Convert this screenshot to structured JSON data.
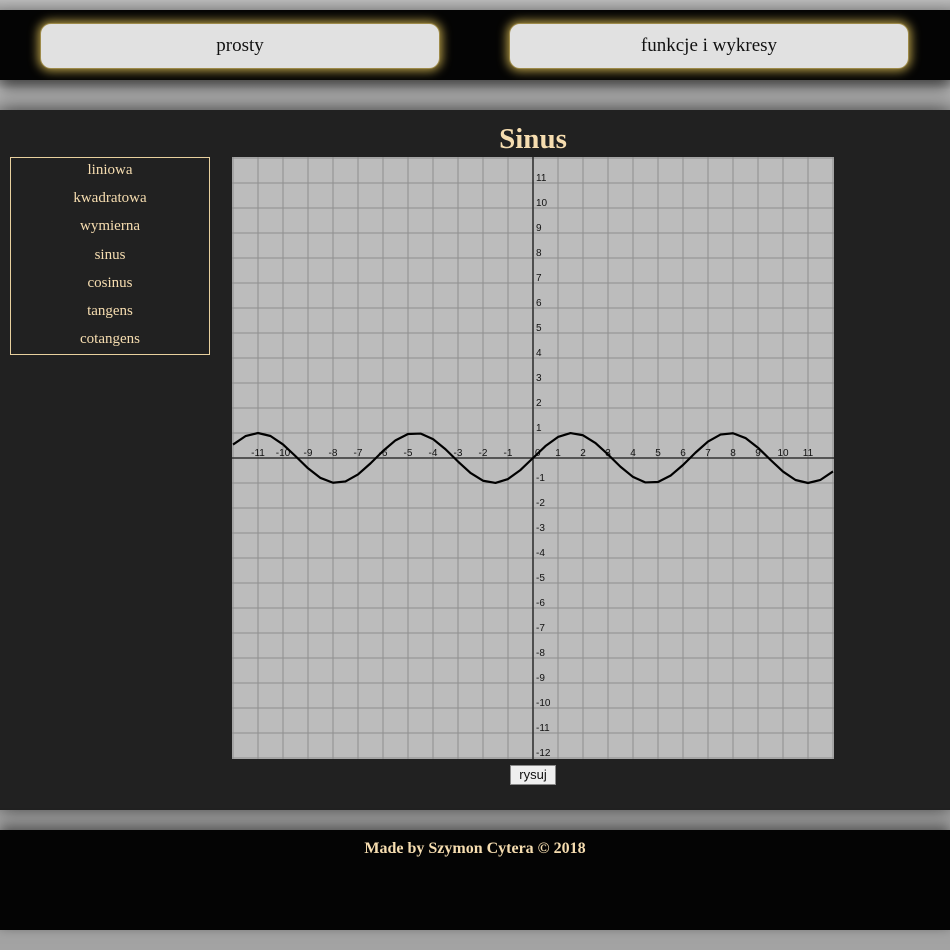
{
  "nav": {
    "items": [
      {
        "label": "prosty"
      },
      {
        "label": "funkcje i wykresy"
      }
    ]
  },
  "page": {
    "title": "Sinus"
  },
  "menu": {
    "items": [
      {
        "label": "liniowa"
      },
      {
        "label": "kwadratowa"
      },
      {
        "label": "wymierna"
      },
      {
        "label": "sinus"
      },
      {
        "label": "cosinus"
      },
      {
        "label": "tangens"
      },
      {
        "label": "cotangens"
      }
    ]
  },
  "controls": {
    "draw_label": "rysuj"
  },
  "footer": {
    "text": "Made by Szymon Cytera © 2018"
  },
  "colors": {
    "accent_text": "#f6ddb0",
    "panel_bg": "#212121",
    "graph_bg": "#bcbcbc"
  },
  "chart_data": {
    "type": "line",
    "title": "Sinus",
    "xlabel": "",
    "ylabel": "",
    "function": "sin(x)",
    "xlim": [
      -12,
      12
    ],
    "ylim": [
      -12,
      12
    ],
    "x_ticks": [
      -11,
      -10,
      -9,
      -8,
      -7,
      -6,
      -5,
      -4,
      -3,
      -2,
      -1,
      0,
      1,
      2,
      3,
      4,
      5,
      6,
      7,
      8,
      9,
      10,
      11
    ],
    "y_ticks": [
      11,
      10,
      9,
      8,
      7,
      6,
      5,
      4,
      3,
      2,
      1,
      -1,
      -2,
      -3,
      -4,
      -5,
      -6,
      -7,
      -8,
      -9,
      -10,
      -11,
      -12
    ],
    "grid": true,
    "series": [
      {
        "name": "",
        "x": [
          -12,
          -11.5,
          -11,
          -10.5,
          -10,
          -9.5,
          -9,
          -8.5,
          -8,
          -7.5,
          -7,
          -6.5,
          -6,
          -5.5,
          -5,
          -4.5,
          -4,
          -3.5,
          -3,
          -2.5,
          -2,
          -1.5,
          -1,
          -0.5,
          0,
          0.5,
          1,
          1.5,
          2,
          2.5,
          3,
          3.5,
          4,
          4.5,
          5,
          5.5,
          6,
          6.5,
          7,
          7.5,
          8,
          8.5,
          9,
          9.5,
          10,
          10.5,
          11,
          11.5,
          12
        ],
        "y": [
          0.537,
          0.876,
          1.0,
          0.88,
          0.544,
          0.075,
          -0.412,
          -0.798,
          -0.989,
          -0.938,
          -0.657,
          -0.215,
          0.279,
          0.706,
          0.959,
          0.978,
          0.757,
          0.351,
          -0.141,
          -0.598,
          -0.909,
          -0.997,
          -0.841,
          -0.479,
          0,
          0.479,
          0.841,
          0.997,
          0.909,
          0.598,
          0.141,
          -0.351,
          -0.757,
          -0.978,
          -0.959,
          -0.706,
          -0.279,
          0.215,
          0.657,
          0.938,
          0.989,
          0.798,
          0.412,
          -0.075,
          -0.544,
          -0.88,
          -1.0,
          -0.876,
          -0.537
        ]
      }
    ]
  }
}
